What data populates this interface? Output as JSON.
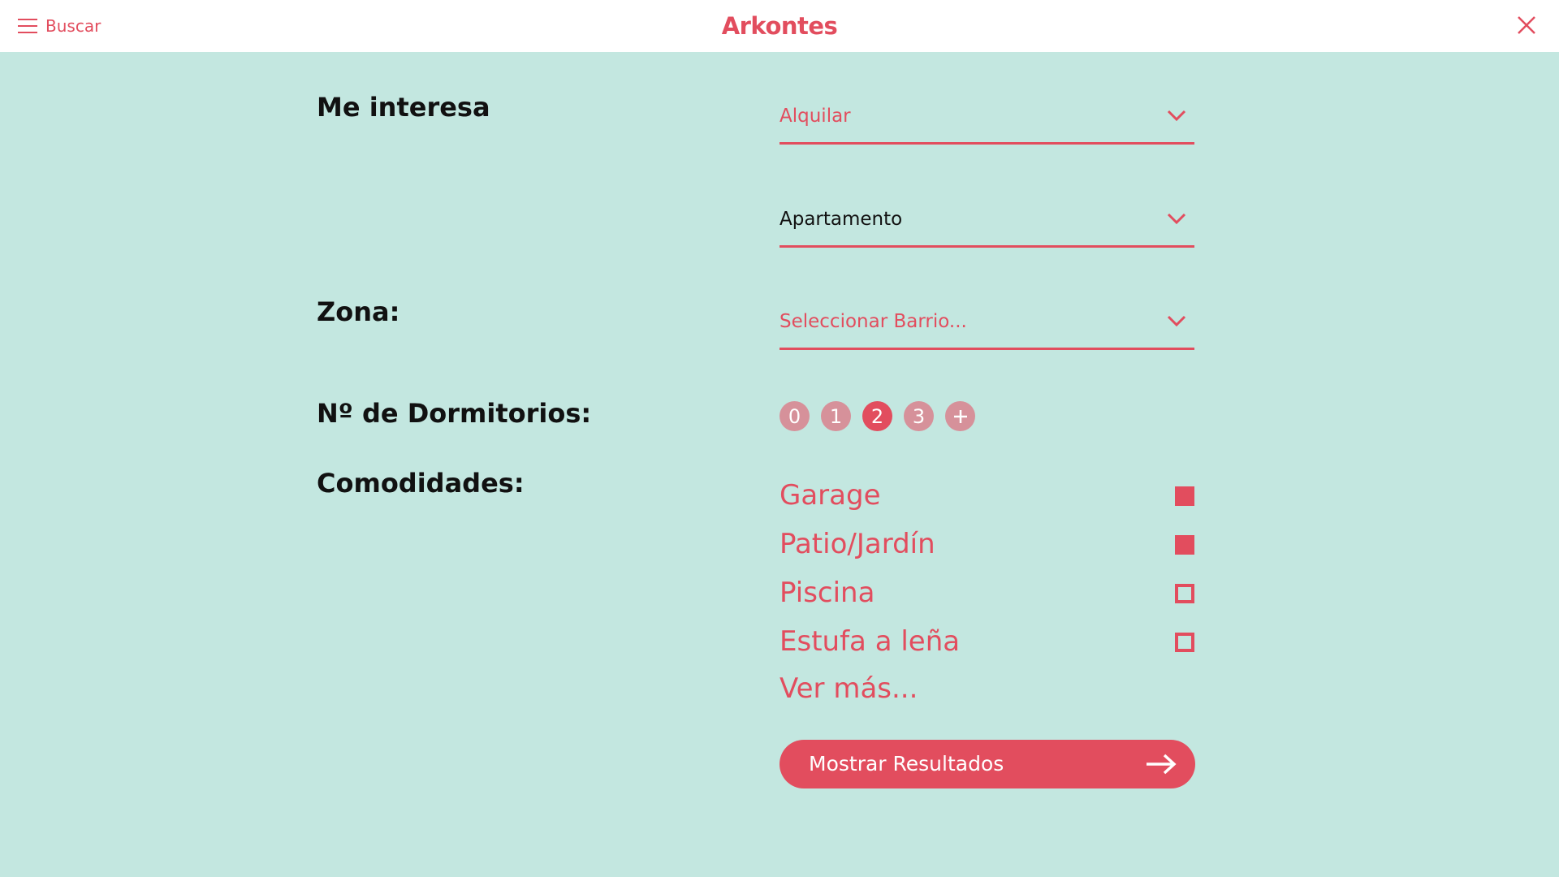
{
  "header": {
    "menu_label": "Buscar",
    "logo_text": "Arkontes",
    "menu_icon": "hamburger-icon",
    "close_icon": "close-icon"
  },
  "form": {
    "interest_label": "Me interesa",
    "operation_value": "Alquilar",
    "property_type_value": "Apartamento",
    "zone_label": "Zona:",
    "zone_placeholder": "Seleccionar Barrio...",
    "bedrooms_label": "Nº de Dormitorios:",
    "bedroom_options": [
      "0",
      "1",
      "2",
      "3"
    ],
    "bedroom_selected": "2",
    "bedroom_more_icon": "plus-icon",
    "amenities_label": "Comodidades:",
    "amenities": [
      {
        "label": "Garage",
        "checked": true
      },
      {
        "label": "Patio/Jardín",
        "checked": true
      },
      {
        "label": "Piscina",
        "checked": false
      },
      {
        "label": "Estufa a leña",
        "checked": false
      }
    ],
    "see_more": "Ver más...",
    "submit_label": "Mostrar Resultados",
    "submit_icon": "arrow-right-icon"
  },
  "colors": {
    "accent": "#e24d5e",
    "background": "#c3e7e0",
    "chip_inactive": "#d6919a",
    "text_dark": "#111111"
  }
}
